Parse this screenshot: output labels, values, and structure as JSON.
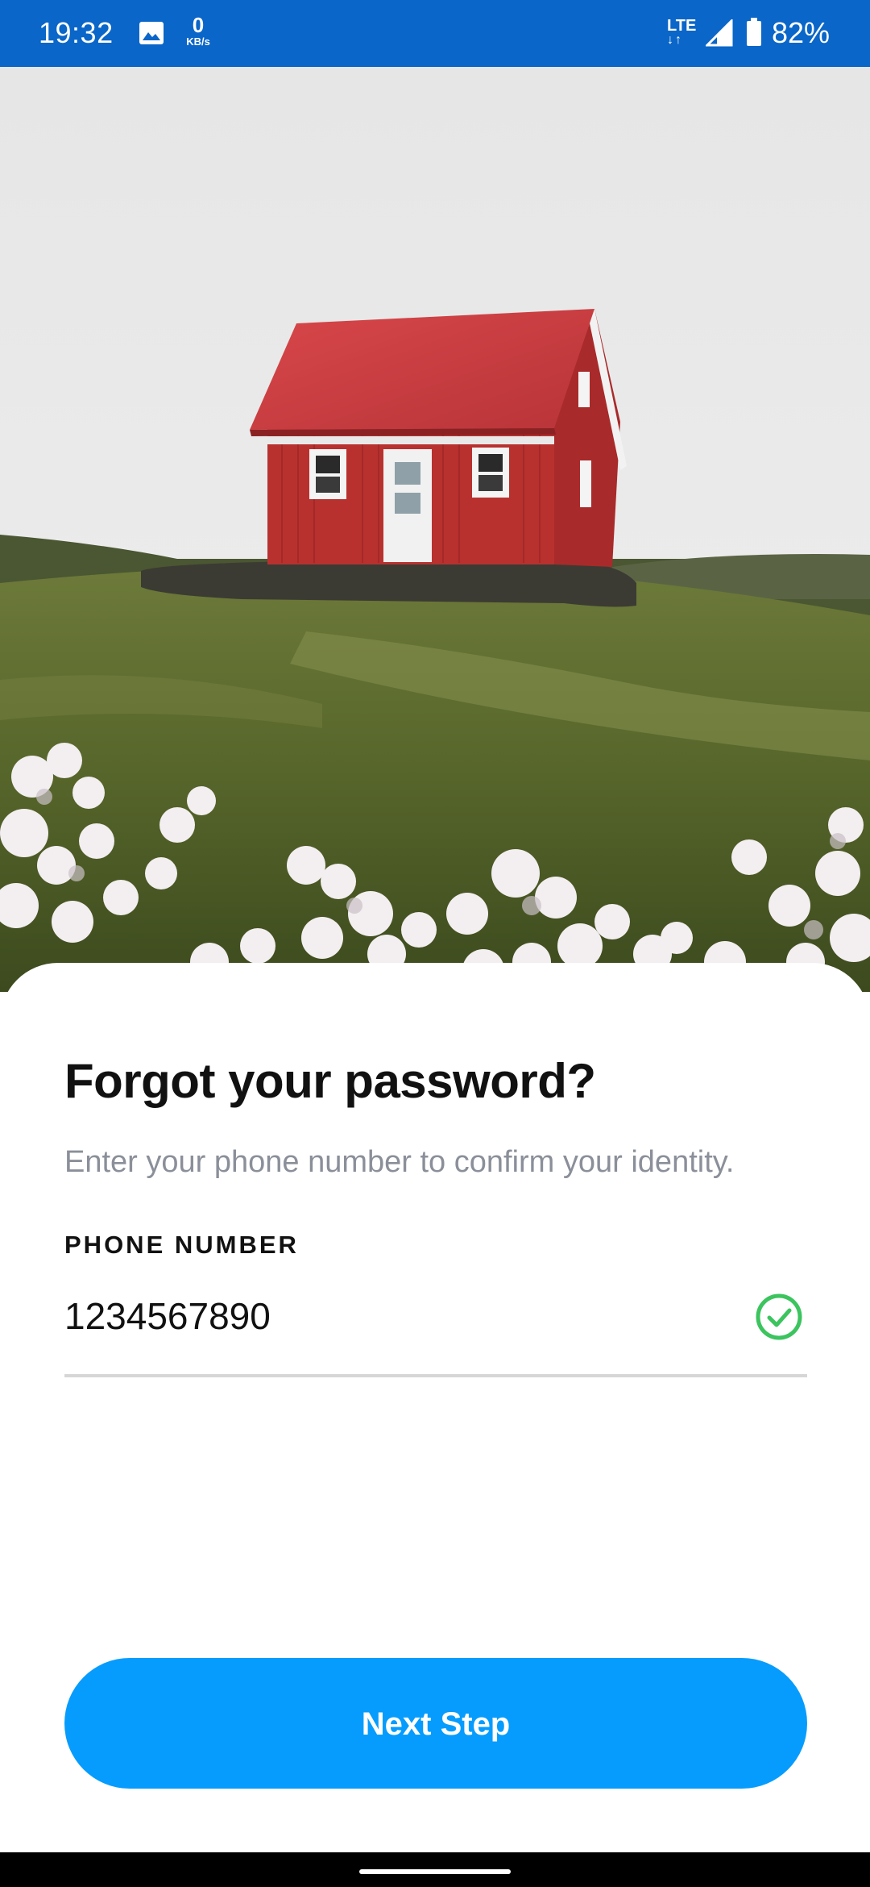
{
  "status_bar": {
    "time": "19:32",
    "net_speed_value": "0",
    "net_speed_unit": "KB/s",
    "network_type": "LTE",
    "battery": "82%",
    "icons": [
      "gallery-icon",
      "signal-icon",
      "battery-icon"
    ]
  },
  "hero": {
    "image": "red house on grassy hill with white flowers"
  },
  "form": {
    "title": "Forgot your password?",
    "subtitle": "Enter your phone number to confirm your identity.",
    "phone_label": "PHONE NUMBER",
    "phone_value": "1234567890",
    "valid_icon": "check-circle-icon"
  },
  "actions": {
    "next_label": "Next Step"
  },
  "colors": {
    "status_bar": "#0a66c8",
    "accent": "#069cfd",
    "valid": "#3cc45f"
  }
}
